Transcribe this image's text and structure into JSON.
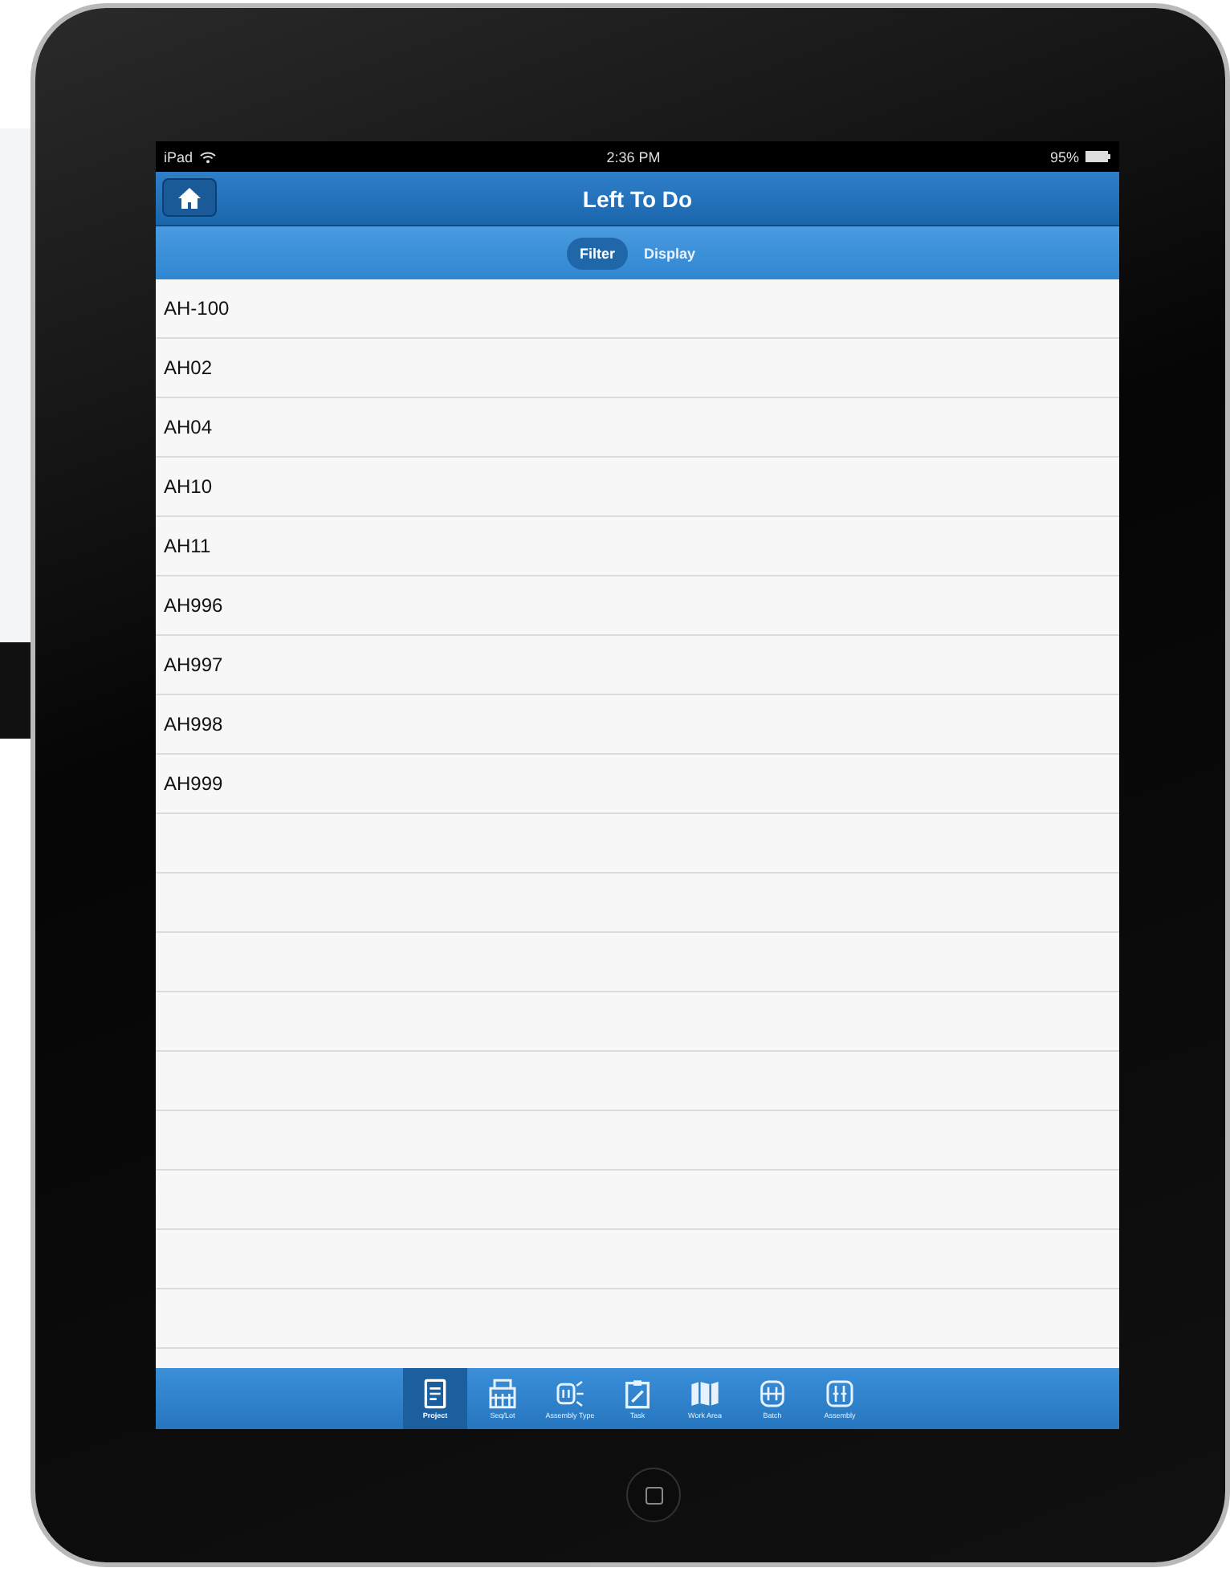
{
  "status_bar": {
    "device": "iPad",
    "time": "2:36 PM",
    "battery": "95%"
  },
  "nav_bar": {
    "title": "Left To Do"
  },
  "segments": [
    {
      "label": "Filter",
      "selected": true
    },
    {
      "label": "Display",
      "selected": false
    }
  ],
  "list": {
    "items": [
      "AH-100",
      "AH02",
      "AH04",
      "AH10",
      "AH11",
      "AH996",
      "AH997",
      "AH998",
      "AH999"
    ]
  },
  "tab_bar": [
    {
      "label": "Project",
      "kind": "document",
      "selected": true
    },
    {
      "label": "Seq/Lot",
      "kind": "building",
      "selected": false
    },
    {
      "label": "Assembly Type",
      "kind": "assembly-type",
      "selected": false
    },
    {
      "label": "Task",
      "kind": "task",
      "selected": false
    },
    {
      "label": "Work Area",
      "kind": "map",
      "selected": false
    },
    {
      "label": "Batch",
      "kind": "batch",
      "selected": false
    },
    {
      "label": "Assembly",
      "kind": "assembly",
      "selected": false
    }
  ]
}
